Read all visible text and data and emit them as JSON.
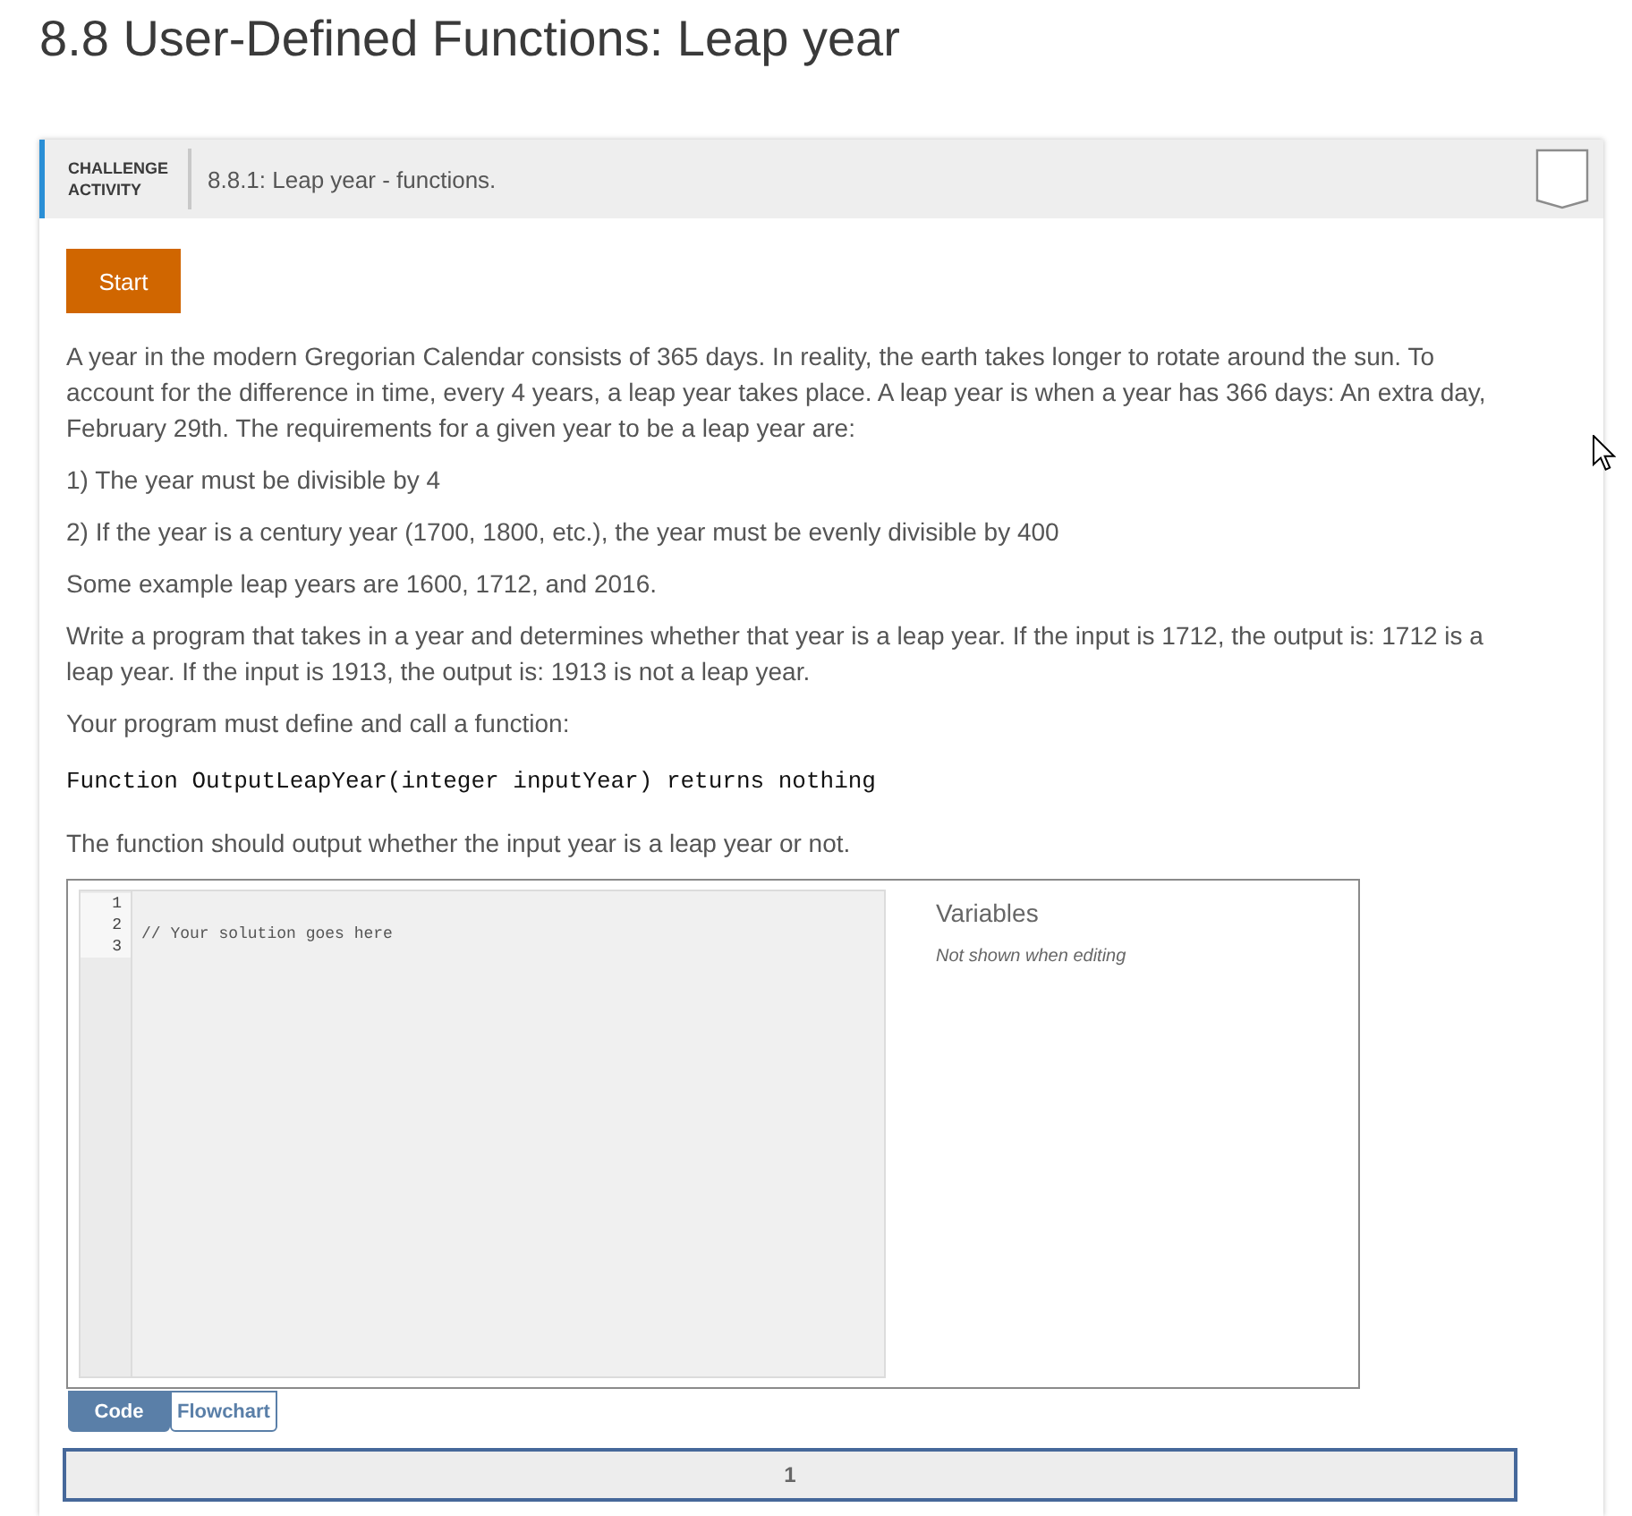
{
  "page_title": "8.8 User-Defined Functions: Leap year",
  "activity": {
    "type_label": "CHALLENGE ACTIVITY",
    "title": "8.8.1: Leap year - functions.",
    "completed": false
  },
  "start_button": "Start",
  "instructions": [
    {
      "kind": "paragraph",
      "text": "A year in the modern Gregorian Calendar consists of 365 days. In reality, the earth takes longer to rotate around the sun. To account for the difference in time, every 4 years, a leap year takes place. A leap year is when a year has 366 days: An extra day, February 29th. The requirements for a given year to be a leap year are:"
    },
    {
      "kind": "paragraph",
      "text": "1) The year must be divisible by 4"
    },
    {
      "kind": "paragraph",
      "text": "2) If the year is a century year (1700, 1800, etc.), the year must be evenly divisible by 400"
    },
    {
      "kind": "paragraph",
      "text": "Some example leap years are 1600, 1712, and 2016."
    },
    {
      "kind": "paragraph",
      "text": "Write a program that takes in a year and determines whether that year is a leap year. If the input is 1712, the output is: 1712 is a leap year. If the input is 1913, the output is: 1913 is not a leap year."
    },
    {
      "kind": "paragraph",
      "text": "Your program must define and call a function:"
    },
    {
      "kind": "code",
      "text": "Function OutputLeapYear(integer inputYear) returns nothing"
    },
    {
      "kind": "paragraph",
      "text": "The function should output whether the input year is a leap year or not."
    }
  ],
  "editor": {
    "lines": [
      {
        "number": "1"
      },
      {
        "number": "2",
        "code": "// Your solution goes here"
      },
      {
        "number": "3"
      }
    ]
  },
  "variables": {
    "title": "Variables",
    "note": "Not shown when editing"
  },
  "tabs": [
    {
      "label": "Code",
      "selected": true
    },
    {
      "label": "Flowchart",
      "selected": false
    }
  ],
  "levels": [
    {
      "label": "1"
    }
  ]
}
